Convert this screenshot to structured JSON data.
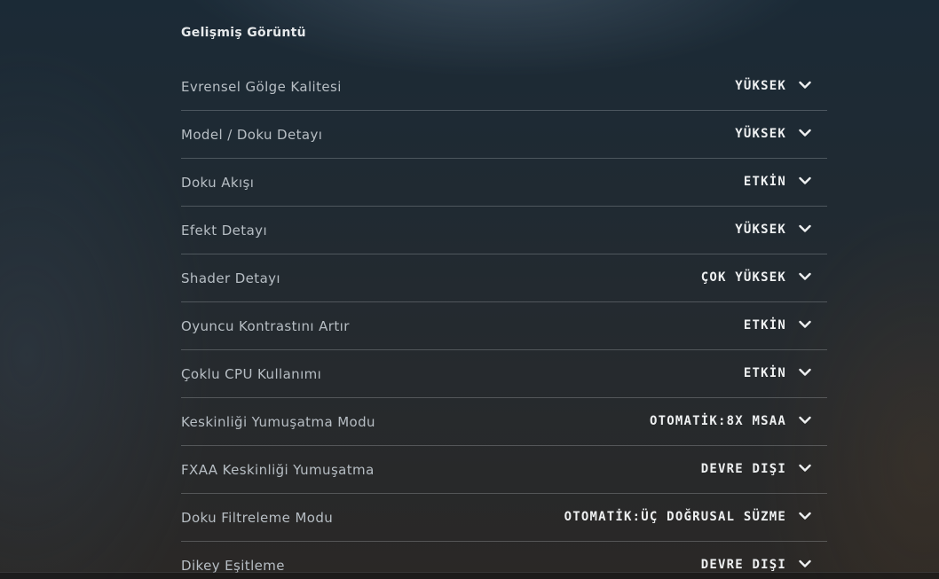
{
  "section": {
    "title": "Gelişmiş Görüntü"
  },
  "settings": [
    {
      "label": "Evrensel Gölge Kalitesi",
      "value": "YÜKSEK",
      "icon": "chevron-down-icon"
    },
    {
      "label": "Model / Doku Detayı",
      "value": "YÜKSEK",
      "icon": "chevron-down-icon"
    },
    {
      "label": "Doku Akışı",
      "value": "ETKİN",
      "icon": "chevron-down-icon"
    },
    {
      "label": "Efekt Detayı",
      "value": "YÜKSEK",
      "icon": "chevron-down-icon"
    },
    {
      "label": "Shader Detayı",
      "value": "ÇOK YÜKSEK",
      "icon": "chevron-down-icon"
    },
    {
      "label": "Oyuncu Kontrastını Artır",
      "value": "ETKİN",
      "icon": "chevron-down-icon"
    },
    {
      "label": "Çoklu CPU Kullanımı",
      "value": "ETKİN",
      "icon": "chevron-down-icon"
    },
    {
      "label": "Keskinliği Yumuşatma Modu",
      "value": "OTOMATİK:8X MSAA",
      "icon": "chevron-down-icon"
    },
    {
      "label": "FXAA Keskinliği Yumuşatma",
      "value": "DEVRE DIŞI",
      "icon": "chevron-down-icon"
    },
    {
      "label": "Doku Filtreleme Modu",
      "value": "OTOMATİK:ÜÇ DOĞRUSAL SÜZME",
      "icon": "chevron-down-icon"
    },
    {
      "label": "Dikey Eşitleme",
      "value": "DEVRE DIŞI",
      "icon": "chevron-down-icon"
    }
  ],
  "colors": {
    "label": "#b7bec4",
    "value": "#eef0f1",
    "divider": "#c8cdd2"
  }
}
